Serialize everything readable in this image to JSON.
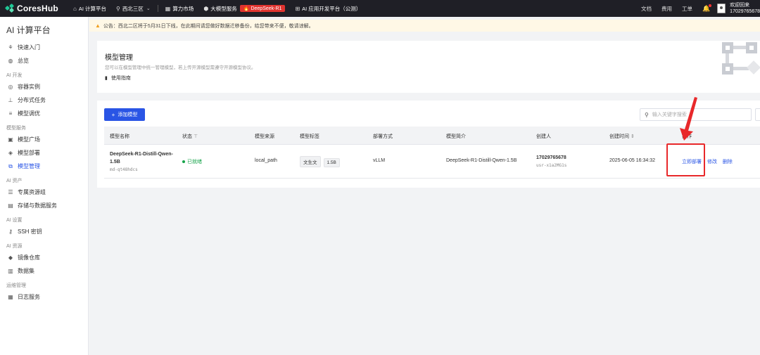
{
  "topbar": {
    "logo": "CoresHub",
    "nav": [
      {
        "label": "AI 计算平台",
        "icon": "home-icon"
      },
      {
        "label": "西北三区",
        "icon": "location-icon"
      },
      {
        "label": "算力市场",
        "icon": "grid-icon"
      },
      {
        "label": "大模型服务",
        "icon": "cube-icon",
        "badge": "DeepSeek-R1"
      },
      {
        "label": "AI 应用开发平台（公测）",
        "icon": "app-icon"
      }
    ],
    "right": [
      "文档",
      "费用",
      "工单"
    ],
    "user_greeting": "欢迎回来",
    "user_id": "17029765678"
  },
  "sidebar": {
    "title": "AI 计算平台",
    "items_top": [
      {
        "label": "快速入门",
        "icon": "tree-icon"
      },
      {
        "label": "总览",
        "icon": "dashboard-icon"
      }
    ],
    "sections": [
      {
        "label": "AI 开发",
        "items": [
          {
            "label": "容器实例",
            "icon": "container-icon"
          },
          {
            "label": "分布式任务",
            "icon": "org-icon"
          },
          {
            "label": "模型调优",
            "icon": "tune-icon"
          }
        ]
      },
      {
        "label": "模型服务",
        "items": [
          {
            "label": "模型广场",
            "icon": "cube-icon"
          },
          {
            "label": "模型部署",
            "icon": "deploy-icon"
          },
          {
            "label": "模型管理",
            "icon": "manage-icon",
            "active": true
          }
        ]
      },
      {
        "label": "AI 资产",
        "items": [
          {
            "label": "专属资源组",
            "icon": "server-icon"
          },
          {
            "label": "存储与数据服务",
            "icon": "storage-icon"
          }
        ]
      },
      {
        "label": "AI 设置",
        "items": [
          {
            "label": "SSH 密钥",
            "icon": "key-icon"
          }
        ]
      },
      {
        "label": "AI 资源",
        "items": [
          {
            "label": "镜像仓库",
            "icon": "image-icon"
          },
          {
            "label": "数据集",
            "icon": "dataset-icon"
          }
        ]
      },
      {
        "label": "运维管理",
        "items": [
          {
            "label": "日志服务",
            "icon": "log-icon"
          }
        ]
      }
    ]
  },
  "notice": "公告：西北二区将于5月31日下线，在此期间请您做好数据迁移备份，给您带来不便，敬请谅解。",
  "header": {
    "title": "模型管理",
    "desc": "您可以在模型管理中统一管理模型，若上传开源模型需遵守开源模型协议。",
    "guide": "使用指南"
  },
  "toolbar": {
    "add_label": "添加模型",
    "search_placeholder": "输入关键字搜索"
  },
  "table": {
    "columns": [
      "模型名称",
      "状态",
      "模型来源",
      "模型标签",
      "部署方式",
      "模型简介",
      "创建人",
      "创建时间",
      "操作"
    ],
    "rows": [
      {
        "name_line1": "DeepSeek-R1-Distill-Qwen-",
        "name_line2": "1.5B",
        "model_id": "md-qt48hdcs",
        "status": "已就绪",
        "source": "local_path",
        "tags": [
          "文生文",
          "1.5B"
        ],
        "deploy": "vLLM",
        "intro": "DeepSeek-R1-Distill-Qwen-1.5B",
        "creator": "17029765678",
        "creator_id": "usr-x1a2MG1s",
        "created_at": "2025-06-05 16:34:32",
        "actions": [
          "立即部署",
          "修改",
          "删除"
        ]
      }
    ]
  },
  "colors": {
    "accent": "#2a55e5",
    "topbar": "#1f1f26",
    "annotation": "#e8282a",
    "ready": "#16a34a"
  }
}
